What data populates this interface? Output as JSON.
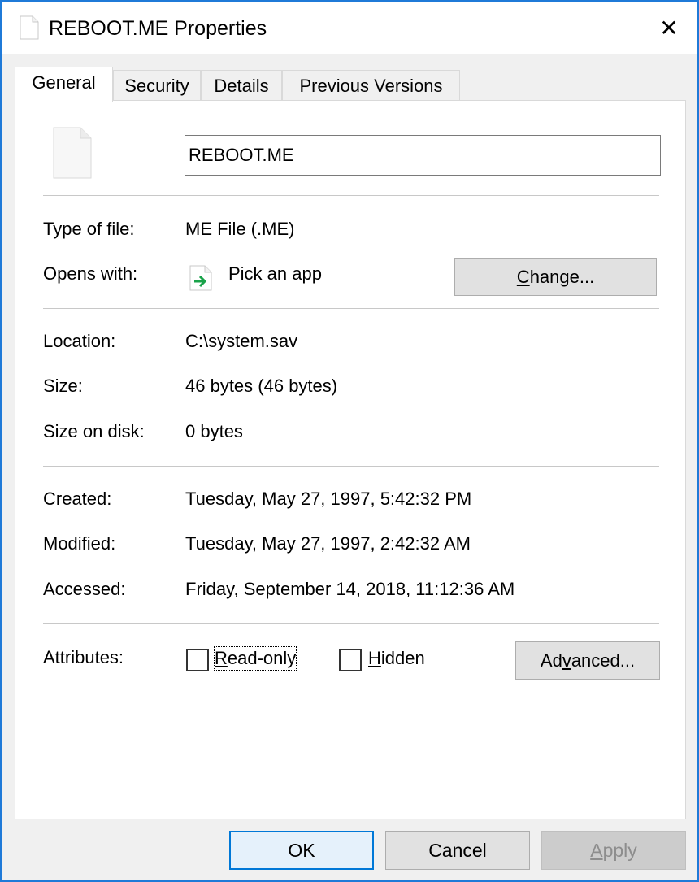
{
  "window": {
    "title": "REBOOT.ME Properties",
    "close_glyph": "✕",
    "accent_color": "#1f7ad8"
  },
  "tabs": [
    {
      "label": "General",
      "active": true
    },
    {
      "label": "Security",
      "active": false
    },
    {
      "label": "Details",
      "active": false
    },
    {
      "label": "Previous Versions",
      "active": false
    }
  ],
  "general": {
    "file_name": "REBOOT.ME",
    "file_icon": "blank-document-icon",
    "type_label": "Type of file:",
    "type_value": "ME File (.ME)",
    "opens_label": "Opens with:",
    "opens_icon": "pick-app-arrow-icon",
    "opens_value": "Pick an app",
    "change_button": {
      "pre": "",
      "accel": "C",
      "post": "hange..."
    },
    "location_label": "Location:",
    "location_value": "C:\\system.sav",
    "size_label": "Size:",
    "size_value": "46 bytes (46 bytes)",
    "size_on_disk_label": "Size on disk:",
    "size_on_disk_value": "0 bytes",
    "created_label": "Created:",
    "created_value": "Tuesday, May 27, 1997, 5:42:32 PM",
    "modified_label": "Modified:",
    "modified_value": "Tuesday, May 27, 1997, 2:42:32 AM",
    "accessed_label": "Accessed:",
    "accessed_value": "Friday, September 14, 2018, 11:12:36 AM",
    "attributes_label": "Attributes:",
    "readonly": {
      "accel": "R",
      "rest": "ead-only",
      "checked": false
    },
    "hidden": {
      "accel": "H",
      "rest": "idden",
      "checked": false
    },
    "advanced_button": {
      "pre": "Ad",
      "accel": "v",
      "post": "anced..."
    }
  },
  "footer": {
    "ok_label": "OK",
    "cancel_label": "Cancel",
    "apply_label": "Apply",
    "apply_accel": "A",
    "apply_rest": "pply",
    "apply_enabled": false
  }
}
